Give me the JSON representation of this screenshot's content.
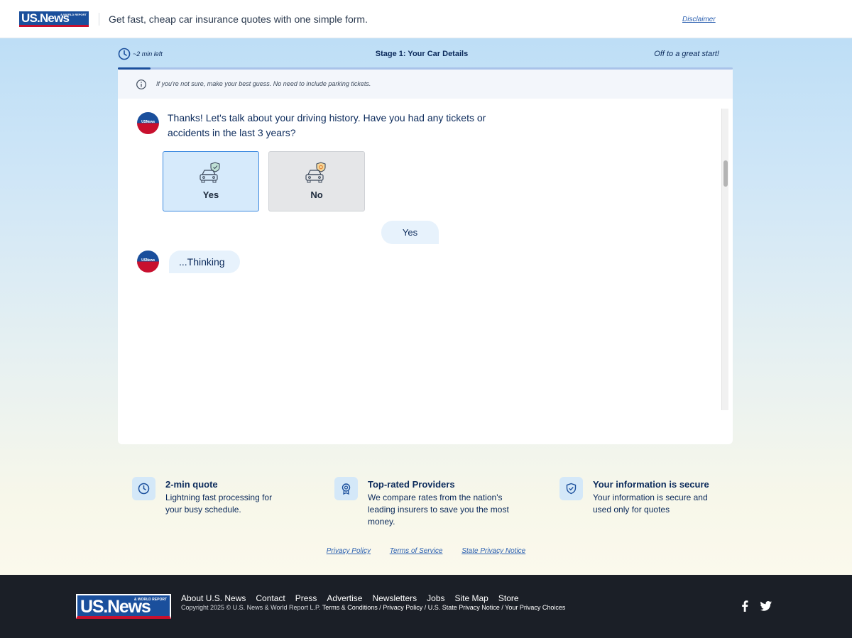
{
  "header": {
    "logo_text": "US.News",
    "logo_subtext": "& WORLD REPORT",
    "tagline": "Get fast, cheap car insurance quotes with one simple form.",
    "disclaimer": "Disclaimer"
  },
  "progress": {
    "time_left": "~2 min left",
    "stage": "Stage 1: Your Car Details",
    "encouragement": "Off to a great start!",
    "fraction": 0.053
  },
  "card": {
    "hint": "If you're not sure, make your best guess. No need to include parking tickets.",
    "avatar_text": "USNews",
    "bot_message": "Thanks! Let's talk about your driving history. Have you had any tickets or accidents in the last 3 years?",
    "options": [
      {
        "label": "Yes",
        "selected": true
      },
      {
        "label": "No",
        "selected": false
      }
    ],
    "user_reply": "Yes",
    "bot_thinking": "...Thinking"
  },
  "features": [
    {
      "title": "2-min quote",
      "desc": "Lightning fast processing for your busy schedule.",
      "icon": "clock-icon"
    },
    {
      "title": "Top-rated Providers",
      "desc": "We compare rates from the nation's leading insurers to save you the most money.",
      "icon": "award-icon"
    },
    {
      "title": "Your information is secure",
      "desc": "Your information is secure and used only for quotes",
      "icon": "shield-check-icon"
    }
  ],
  "legal_links": [
    "Privacy Policy",
    "Terms of Service",
    "State Privacy Notice"
  ],
  "footer": {
    "logo_text": "US.News",
    "logo_subtext": "& WORLD REPORT",
    "nav": [
      "About U.S. News",
      "Contact",
      "Press",
      "Advertise",
      "Newsletters",
      "Jobs",
      "Site Map",
      "Store"
    ],
    "copyright": "Copyright 2025 © U.S. News & World Report L.P.",
    "policy_links": "Terms & Conditions / Privacy Policy / U.S. State Privacy Notice / Your Privacy Choices",
    "social": [
      "facebook-icon",
      "twitter-icon"
    ]
  },
  "colors": {
    "brand_blue": "#1a4f9c",
    "brand_red": "#c8102e",
    "text_navy": "#0b2a5b",
    "selected_bg": "#d6eafb",
    "selected_border": "#3f8be0"
  }
}
